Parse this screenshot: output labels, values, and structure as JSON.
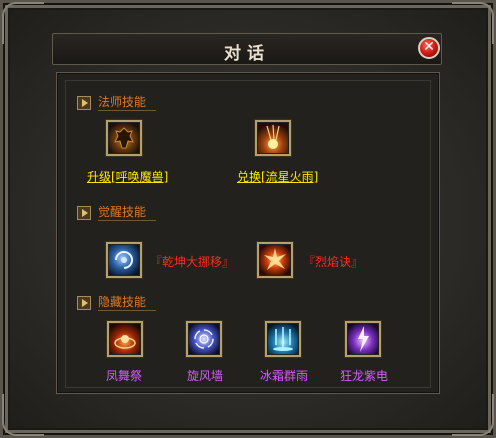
{
  "dialog": {
    "title": "对话"
  },
  "sections": [
    {
      "label": "法师技能",
      "skills": [
        {
          "label": "升级[呼唤魔兽]",
          "icon": "beast-summon-icon"
        },
        {
          "label": "兑换[流星火雨]",
          "icon": "meteor-rain-icon"
        }
      ]
    },
    {
      "label": "觉醒技能",
      "skills": [
        {
          "label": "『乾坤大挪移』",
          "icon": "teleport-spiral-icon"
        },
        {
          "label": "『烈焰诀』",
          "icon": "flame-burst-icon"
        }
      ]
    },
    {
      "label": "隐藏技能",
      "skills": [
        {
          "label": "凤舞祭",
          "icon": "phoenix-dance-icon"
        },
        {
          "label": "旋风墙",
          "icon": "whirlwind-wall-icon"
        },
        {
          "label": "冰霜群雨",
          "icon": "frost-rain-icon"
        },
        {
          "label": "狂龙紫电",
          "icon": "purple-lightning-icon"
        }
      ]
    }
  ],
  "colors": {
    "link_yellow": "#ffe800",
    "awaken_red": "#ff2a1a",
    "hidden_purple": "#d85cff",
    "section_orange": "#e07824"
  }
}
